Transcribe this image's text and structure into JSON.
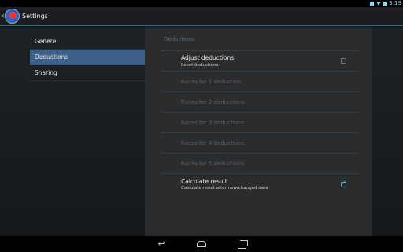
{
  "status_bar": {
    "time": "3:19",
    "icons": [
      "notification-icon",
      "wifi-icon",
      "battery-icon"
    ]
  },
  "action_bar": {
    "title": "Settings",
    "back_glyph": "‹"
  },
  "nav": {
    "items": [
      {
        "label": "Generel",
        "active": false
      },
      {
        "label": "Deductions",
        "active": true
      },
      {
        "label": "Sharing",
        "active": false
      }
    ]
  },
  "pane": {
    "section_title": "Deductions",
    "prefs": [
      {
        "title": "Adjust deductions",
        "summary": "Reset deductions",
        "enabled": true,
        "checkbox": true,
        "checked": false
      },
      {
        "title": "Races for 1 deduction",
        "summary": "",
        "enabled": false,
        "checkbox": false,
        "checked": false
      },
      {
        "title": "Races for 2 deductions",
        "summary": "",
        "enabled": false,
        "checkbox": false,
        "checked": false
      },
      {
        "title": "Races for 3 deductions",
        "summary": "",
        "enabled": false,
        "checkbox": false,
        "checked": false
      },
      {
        "title": "Races for 4 deductions",
        "summary": "",
        "enabled": false,
        "checkbox": false,
        "checked": false
      },
      {
        "title": "Races for 5 deductions",
        "summary": "",
        "enabled": false,
        "checkbox": false,
        "checked": false
      },
      {
        "title": "Calculate result",
        "summary": "Calculate result after new/changed data",
        "enabled": true,
        "checkbox": true,
        "checked": true
      }
    ]
  },
  "colors": {
    "accent": "#33b5e5",
    "active_nav": "#3e5f87"
  }
}
